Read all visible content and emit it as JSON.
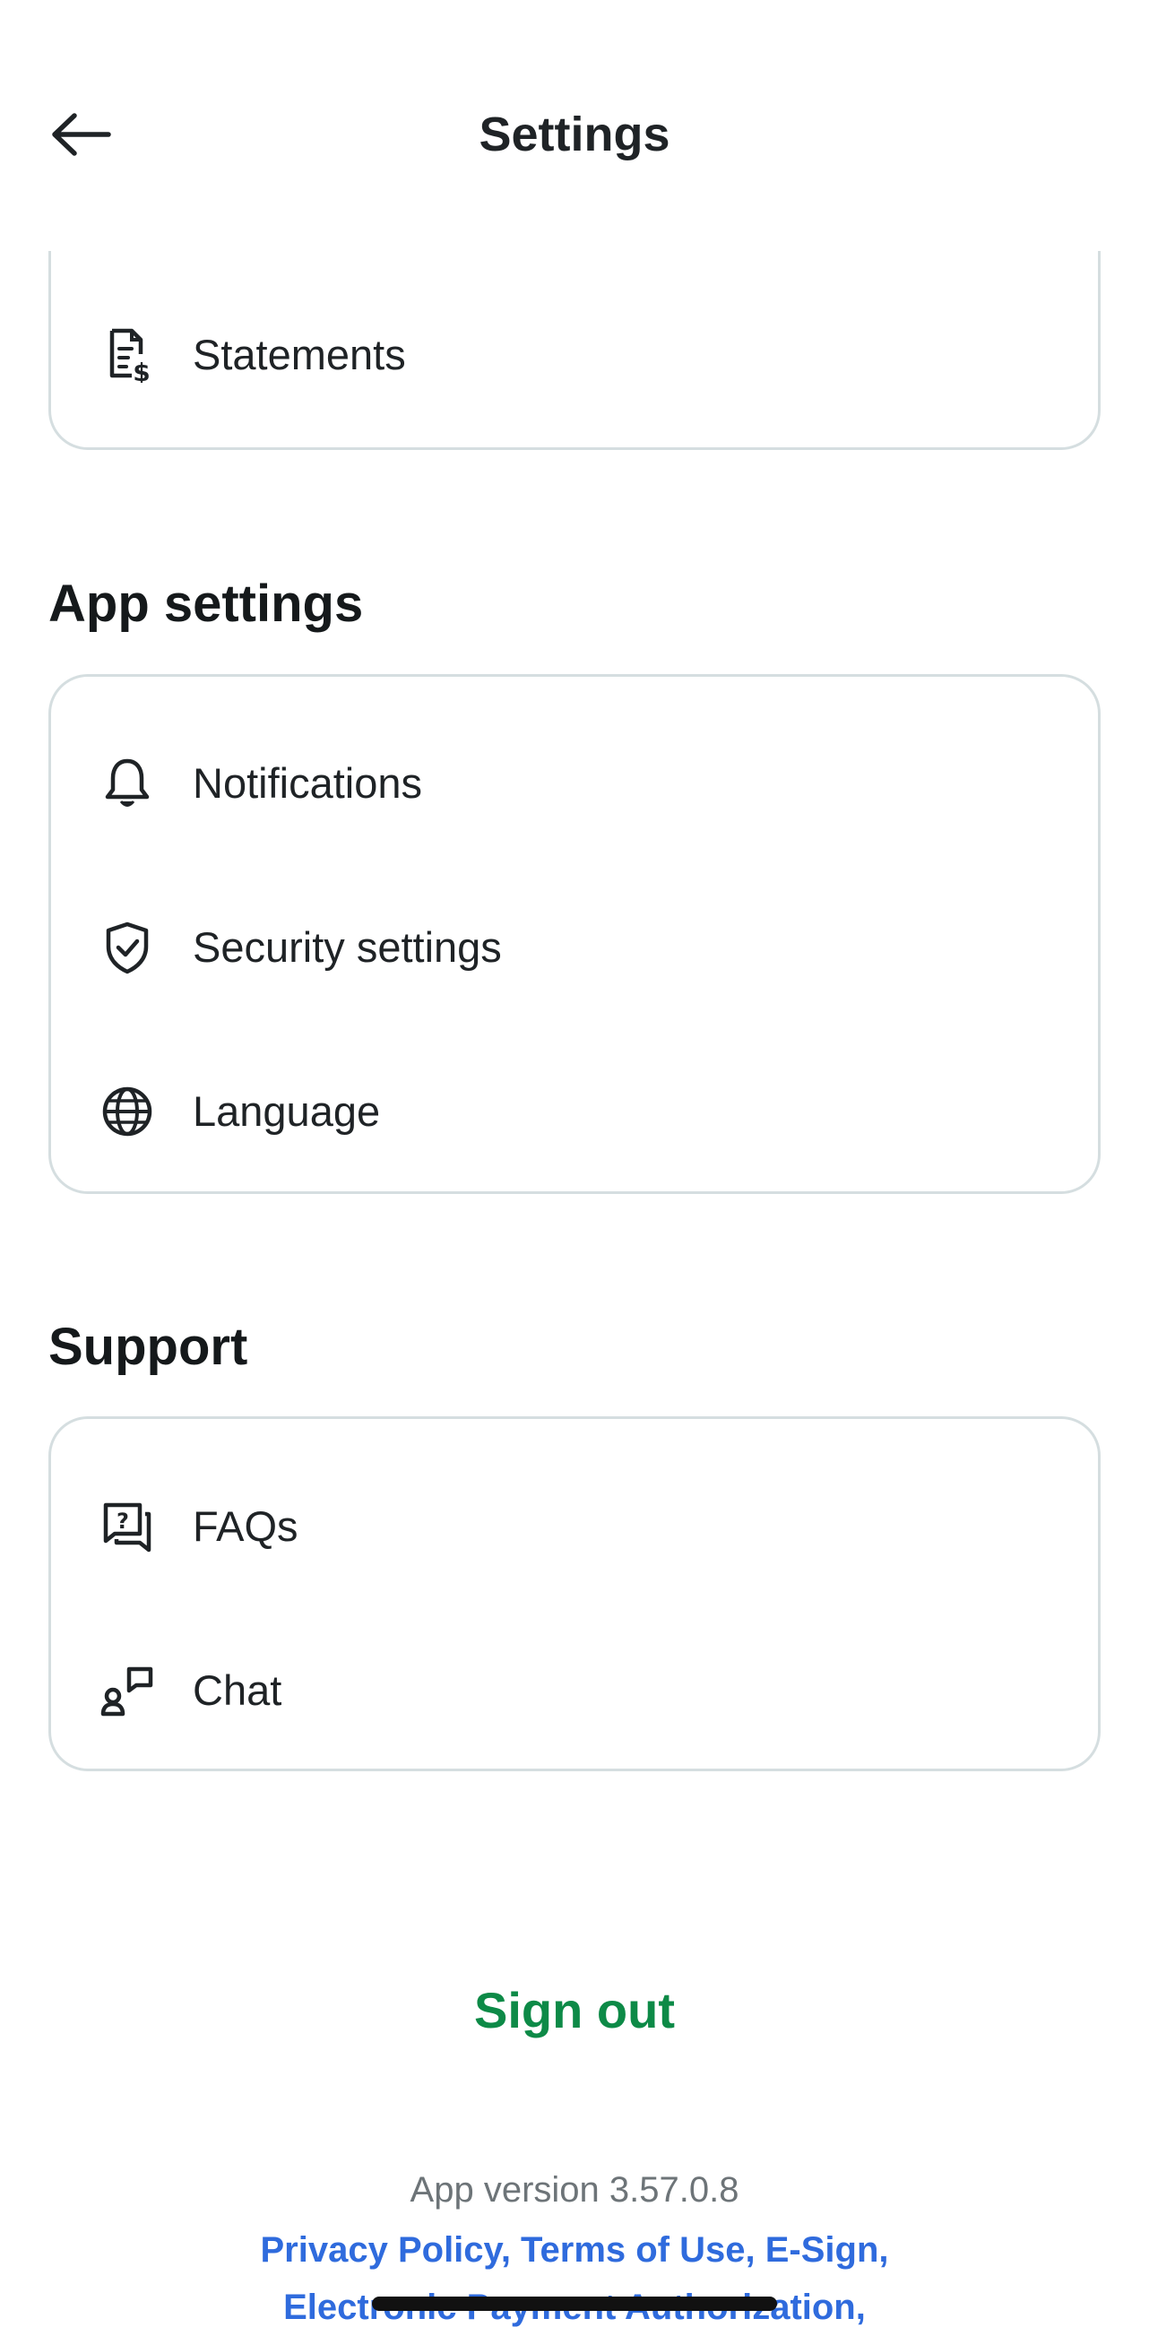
{
  "header": {
    "title": "Settings",
    "back_icon": "arrow-left-icon"
  },
  "account_card": {
    "items": [
      {
        "label": "Statements",
        "icon": "statement-dollar-icon"
      }
    ]
  },
  "app_settings": {
    "title": "App settings",
    "items": [
      {
        "label": "Notifications",
        "icon": "bell-icon"
      },
      {
        "label": "Security settings",
        "icon": "shield-check-icon"
      },
      {
        "label": "Language",
        "icon": "globe-icon"
      }
    ]
  },
  "support": {
    "title": "Support",
    "items": [
      {
        "label": "FAQs",
        "icon": "faq-chat-icon"
      },
      {
        "label": "Chat",
        "icon": "person-chat-icon"
      }
    ]
  },
  "footer": {
    "sign_out": "Sign out",
    "version": "App version 3.57.0.8",
    "legal_line1": "Privacy Policy, Terms of Use, E-Sign,",
    "legal_line2": "Electronic Payment Authorization,"
  },
  "colors": {
    "accent_green": "#0d8a47",
    "link_blue": "#2f6bdd",
    "card_border": "#d5dee0",
    "muted_text": "#6d7478"
  }
}
